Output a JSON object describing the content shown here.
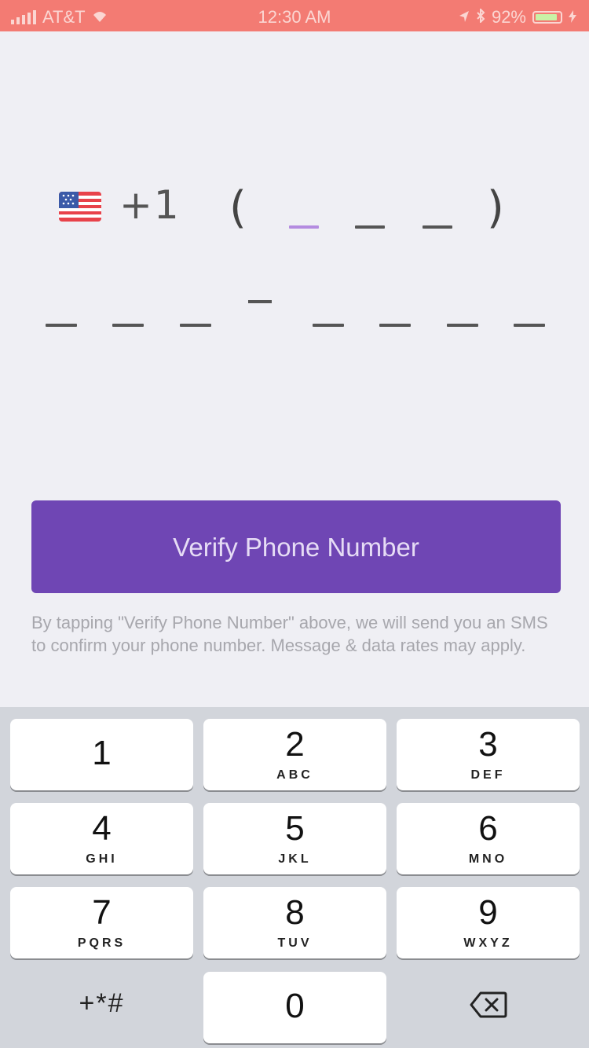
{
  "status_bar": {
    "carrier": "AT&T",
    "wifi_icon": "wifi-icon",
    "time": "12:30 AM",
    "battery_percent": "92%",
    "battery_level": 0.92
  },
  "phone_entry": {
    "flag_icon": "us-flag-icon",
    "country_code": "+1",
    "open_paren": "(",
    "close_paren": ")"
  },
  "verify_button": {
    "label": "Verify Phone Number"
  },
  "disclaimer": "By tapping \"Verify Phone Number\" above, we will send you an SMS to confirm your phone number. Message & data rates may apply.",
  "keypad": {
    "keys": [
      {
        "num": "1",
        "letters": ""
      },
      {
        "num": "2",
        "letters": "ABC"
      },
      {
        "num": "3",
        "letters": "DEF"
      },
      {
        "num": "4",
        "letters": "GHI"
      },
      {
        "num": "5",
        "letters": "JKL"
      },
      {
        "num": "6",
        "letters": "MNO"
      },
      {
        "num": "7",
        "letters": "PQRS"
      },
      {
        "num": "8",
        "letters": "TUV"
      },
      {
        "num": "9",
        "letters": "WXYZ"
      },
      {
        "num": "0",
        "letters": ""
      }
    ],
    "symbols_label": "+*#",
    "delete_icon": "backspace-icon"
  },
  "colors": {
    "status_bar": "#f37b73",
    "button": "#6f46b4",
    "active_slot": "#b48be0"
  }
}
